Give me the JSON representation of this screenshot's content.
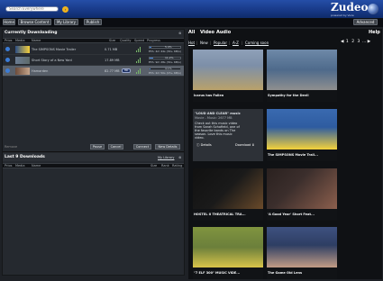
{
  "header": {
    "search_placeholder": "Search Everywhere",
    "search_go_icon": "search-go-icon",
    "logo": "Zudeo",
    "logo_subtitle": "powered by Vuze"
  },
  "nav": {
    "items": [
      {
        "label": "Home"
      },
      {
        "label": "Browse Content"
      },
      {
        "label": "My Library"
      },
      {
        "label": "Publish"
      }
    ],
    "advanced": "Advanced"
  },
  "downloading": {
    "title": "Currently Downloading",
    "columns": [
      "Prios",
      "Media",
      "Name",
      "Size",
      "Quality",
      "Speed",
      "Progress"
    ],
    "rows": [
      {
        "name": "The SIMPSONS Movie Trailer",
        "size": "0.71 MB",
        "progress": 0.05,
        "progress_text": "5.4%",
        "eta_text": "ETA: 4m 44s (30+ KB/s)",
        "hd": false
      },
      {
        "name": "Short Story of a New Yard",
        "size": "17.89 MB",
        "progress": 0.11,
        "progress_text": "11.2%",
        "eta_text": "ETA: 9m 28s (30+ KB/s)",
        "hd": false
      },
      {
        "name": "Hamarden",
        "size": "82.77 MB",
        "progress": 0.04,
        "progress_text": "4.1%",
        "eta_text": "ETA: 2m 50s (15+ KB/s)",
        "hd": true,
        "hd_label": "HD"
      }
    ],
    "bottom_left": "Remove",
    "buttons": [
      "Pause",
      "Cancel",
      "Connect",
      "New Details"
    ]
  },
  "last9": {
    "title": "Last 9 Downloads",
    "my_library_link": "My Library",
    "columns": [
      "Prios",
      "Media",
      "Name",
      "Size",
      "Rank",
      "Rating"
    ]
  },
  "browse": {
    "tabs": [
      "All",
      "Video",
      "Audio"
    ],
    "help": "Help",
    "filters": [
      "Hot",
      "New",
      "Popular",
      "A-Z",
      "Coming soon"
    ],
    "pager": {
      "prev": "◀",
      "pages": [
        "1",
        "2",
        "3"
      ],
      "current": "1",
      "ellipsis": "…",
      "next": "▶"
    },
    "cards": [
      {
        "title": "Icarus has Fallen",
        "color_top": "#7d8fa8",
        "color_bottom": "#b9a16a"
      },
      {
        "title": "Sympathy for the Devil",
        "color_top": "#4e6a8b",
        "color_bottom": "#8f8f8f"
      },
      {
        "text_card": true,
        "quote": "\"LOUD AND CLEAR\" music",
        "sub": "Movie - Music: 2677 MB",
        "desc1": "Check out this music video",
        "desc2": "from Sarah Schofield, one of",
        "desc3": "the favorite bands on The",
        "desc4": "season. Love this music",
        "desc5": "video.",
        "details": "Details",
        "download": "Download"
      },
      {
        "title": "The SIMPSONS Movie Trail...",
        "color_top": "#2e5ca0",
        "color_bottom": "#f4d23b"
      },
      {
        "title": "HOSTEL II THEATRICAL TRA...",
        "color_top": "#1a1a1a",
        "color_bottom": "#6a4a2a"
      },
      {
        "title": "'A Good Year' Short Feat...",
        "color_top": "#3b2e2c",
        "color_bottom": "#8c5f4d"
      },
      {
        "title": "\"7 ELF 300\" MUSIC VIDE...",
        "color_top": "#6b7f3b",
        "color_bottom": "#d8c44a"
      },
      {
        "title": "The Game Old Lens",
        "color_top": "#2e3e63",
        "color_bottom": "#c29c85"
      }
    ]
  }
}
